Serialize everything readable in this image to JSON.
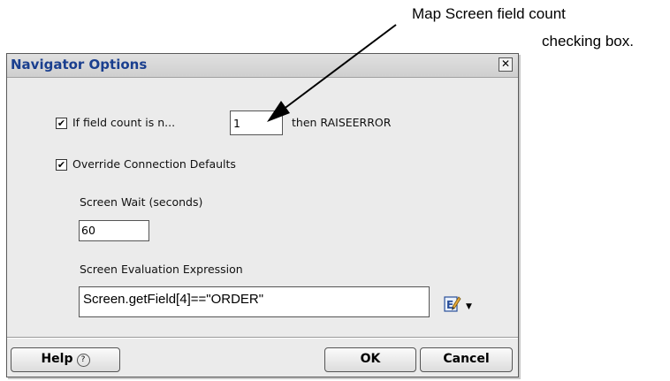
{
  "annotation": {
    "line1": "Map Screen field count",
    "line2": "checking box."
  },
  "dialog": {
    "title": "Navigator Options",
    "close_glyph": "✕",
    "field_count_checkbox": {
      "checked": true,
      "glyph": "✔"
    },
    "field_count_label": "If field count is n...",
    "field_count_value": "1",
    "then_label": "then RAISEERROR",
    "override_checkbox": {
      "checked": true,
      "glyph": "✔"
    },
    "override_label": "Override Connection Defaults",
    "screen_wait_label": "Screen Wait (seconds)",
    "screen_wait_value": "60",
    "screen_eval_label": "Screen Evaluation Expression",
    "screen_eval_value": "Screen.getField[4]==\"ORDER\"",
    "editor_icon": "edit-expression-icon",
    "dropdown_glyph": "▼",
    "help_label": "Help",
    "help_glyph": "?",
    "ok_label": "OK",
    "cancel_label": "Cancel"
  },
  "colors": {
    "title_text": "#1a3f8f",
    "dialog_bg": "#ebebeb"
  }
}
